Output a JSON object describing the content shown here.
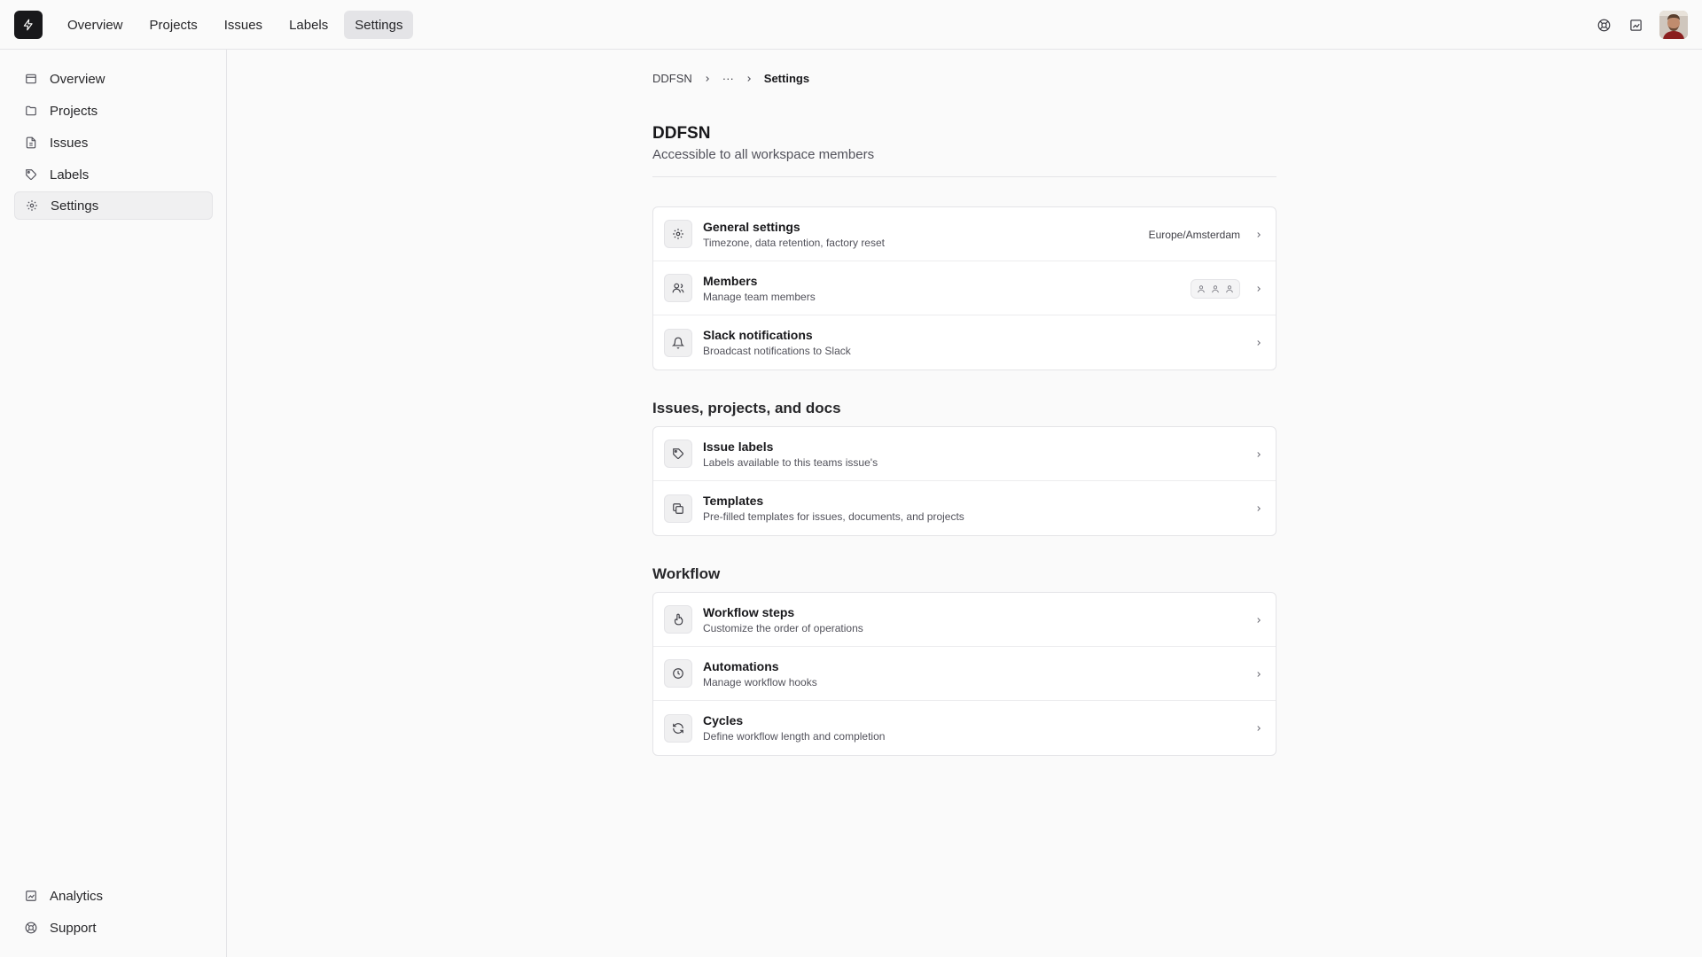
{
  "topnav": {
    "tabs": [
      {
        "label": "Overview"
      },
      {
        "label": "Projects"
      },
      {
        "label": "Issues"
      },
      {
        "label": "Labels"
      },
      {
        "label": "Settings",
        "active": true
      }
    ],
    "icons": [
      "logo-bolt-icon",
      "support-icon",
      "analytics-icon",
      "user-avatar"
    ]
  },
  "sidebar": {
    "items": [
      {
        "label": "Overview",
        "icon": "inbox-icon"
      },
      {
        "label": "Projects",
        "icon": "folder-icon"
      },
      {
        "label": "Issues",
        "icon": "file-icon"
      },
      {
        "label": "Labels",
        "icon": "tag-icon"
      },
      {
        "label": "Settings",
        "icon": "gear-icon",
        "active": true
      }
    ],
    "bottom": [
      {
        "label": "Analytics",
        "icon": "analytics-icon"
      },
      {
        "label": "Support",
        "icon": "support-icon"
      }
    ]
  },
  "breadcrumb": {
    "items": [
      "DDFSN",
      "···",
      "Settings"
    ]
  },
  "page": {
    "title": "DDFSN",
    "subtitle": "Accessible to all workspace members"
  },
  "sections": {
    "general": {
      "rows": [
        {
          "title": "General settings",
          "desc": "Timezone, data retention, factory reset",
          "value": "Europe/Amsterdam",
          "icon": "gear-icon"
        },
        {
          "title": "Members",
          "desc": "Manage team members",
          "icon": "users-icon",
          "member_icons": [
            "user-icon",
            "user-icon",
            "user-icon"
          ]
        },
        {
          "title": "Slack notifications",
          "desc": "Broadcast notifications to Slack",
          "icon": "bell-icon"
        }
      ]
    },
    "issues": {
      "title": "Issues, projects, and docs",
      "rows": [
        {
          "title": "Issue labels",
          "desc": "Labels available to this teams issue's",
          "icon": "tag-icon"
        },
        {
          "title": "Templates",
          "desc": "Pre-filled templates for issues, documents, and projects",
          "icon": "copy-icon"
        }
      ]
    },
    "workflow": {
      "title": "Workflow",
      "rows": [
        {
          "title": "Workflow steps",
          "desc": "Customize the order of operations",
          "icon": "pointer-icon"
        },
        {
          "title": "Automations",
          "desc": "Manage workflow hooks",
          "icon": "clock-icon"
        },
        {
          "title": "Cycles",
          "desc": "Define workflow length and completion",
          "icon": "refresh-icon"
        }
      ]
    }
  },
  "colors": {
    "background": "#fafafa",
    "card": "#ffffff",
    "border": "#e4e4e7",
    "text": "#18181b",
    "muted": "#52525b",
    "active_tab": "#e4e4e7"
  }
}
